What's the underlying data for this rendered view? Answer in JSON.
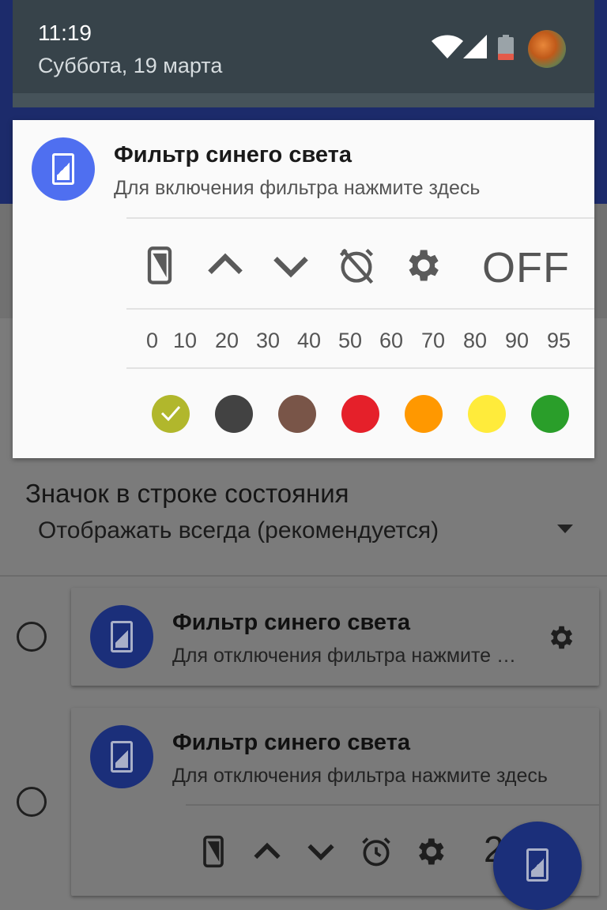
{
  "status_bar": {
    "time": "11:19",
    "date": "Суббота, 19 марта",
    "icons": [
      "wifi-icon",
      "signal-icon",
      "battery-low-icon",
      "avatar"
    ]
  },
  "notification": {
    "title": "Фильтр синего света",
    "text": "Для включения фильтра нажмите здесь",
    "controls": [
      "toggle-filter-icon",
      "chevron-up-icon",
      "chevron-down-icon",
      "alarm-off-icon",
      "gear-icon"
    ],
    "off_label": "OFF",
    "levels": [
      "0",
      "10",
      "20",
      "30",
      "40",
      "50",
      "60",
      "70",
      "80",
      "90",
      "95"
    ],
    "colors": [
      {
        "name": "olive",
        "hex": "#b1b72c",
        "selected": true
      },
      {
        "name": "dark-gray",
        "hex": "#424242",
        "selected": false
      },
      {
        "name": "brown",
        "hex": "#795548",
        "selected": false
      },
      {
        "name": "red",
        "hex": "#e5202a",
        "selected": false
      },
      {
        "name": "orange",
        "hex": "#ff9800",
        "selected": false
      },
      {
        "name": "yellow",
        "hex": "#ffeb3b",
        "selected": false
      },
      {
        "name": "green",
        "hex": "#2a9e2a",
        "selected": false
      }
    ]
  },
  "settings": {
    "section_title": "Значок в строке состояния",
    "dropdown_value": "Отображать всегда (рекомендуется)",
    "options": [
      {
        "title": "Фильтр синего света",
        "text": "Для отключения фильтра нажмите здесь",
        "selected": false
      },
      {
        "title": "Фильтр синего света",
        "text": "Для отключения фильтра нажмите здесь",
        "selected": false,
        "brightness_peek": "2"
      }
    ]
  },
  "colors": {
    "accent": "#4f6ff0",
    "app_bar": "#1c2b6b",
    "shade": "#37434a"
  }
}
